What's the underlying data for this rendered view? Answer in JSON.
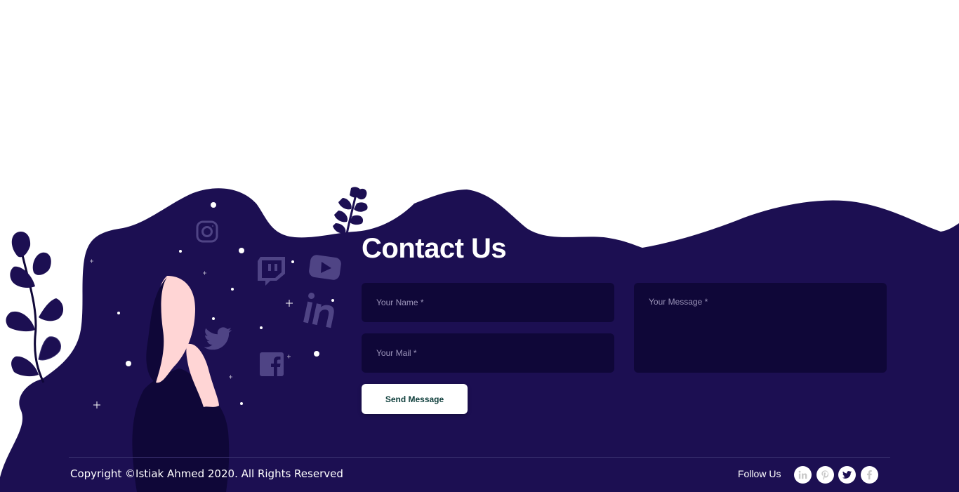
{
  "contact": {
    "heading": "Contact Us",
    "name_placeholder": "Your Name *",
    "mail_placeholder": "Your Mail *",
    "message_placeholder": "Your Message *",
    "send_label": "Send Message"
  },
  "footer": {
    "copyright": "Copyright ©Istiak Ahmed 2020. All Rights Reserved",
    "follow_label": "Follow Us",
    "social_icons": [
      "linkedin-icon",
      "pinterest-icon",
      "twitter-icon",
      "facebook-icon"
    ]
  },
  "colors": {
    "background": "#1c0f52",
    "field": "#0f0738",
    "text": "#ffffff",
    "button_text": "#0d3d3a",
    "skin": "#ffd5d5"
  },
  "illustration": {
    "floating_icons": [
      "instagram-icon",
      "twitch-icon",
      "youtube-icon",
      "linkedin-icon",
      "twitter-icon",
      "facebook-icon"
    ]
  }
}
